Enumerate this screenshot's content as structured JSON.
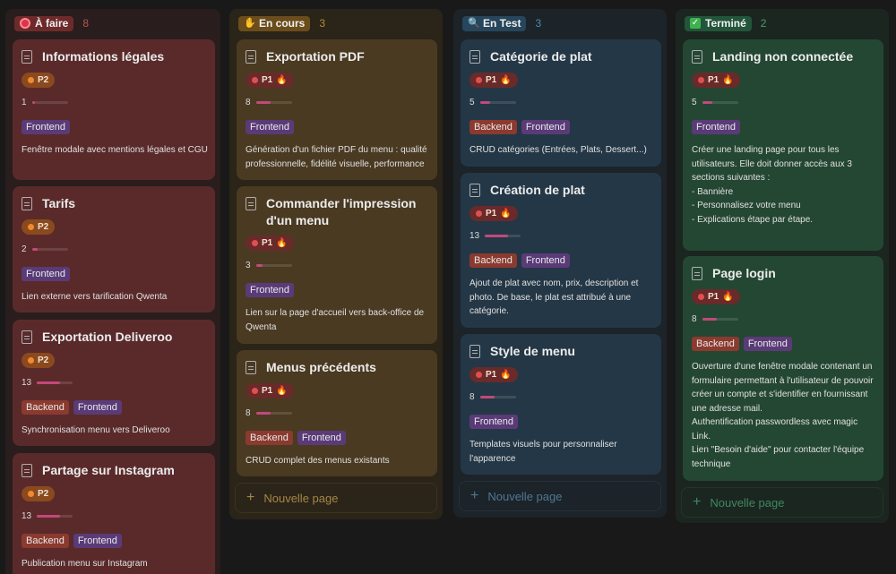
{
  "columns": [
    {
      "status": "À faire",
      "count": "8",
      "icon": "stop-sign-icon",
      "cards": [
        {
          "title": "Informations légales",
          "priority": "P2",
          "points": "1",
          "progress": 0.08,
          "tags": [
            "Frontend"
          ],
          "description": "Fenêtre modale avec mentions légales et CGU"
        },
        {
          "title": "Tarifs",
          "priority": "P2",
          "points": "2",
          "progress": 0.15,
          "tags": [
            "Frontend"
          ],
          "description": "Lien externe vers tarification Qwenta"
        },
        {
          "title": "Exportation Deliveroo",
          "priority": "P2",
          "points": "13",
          "progress": 0.65,
          "tags": [
            "Backend",
            "Frontend"
          ],
          "description": "Synchronisation menu vers Deliveroo"
        },
        {
          "title": "Partage sur Instagram",
          "priority": "P2",
          "points": "13",
          "progress": 0.65,
          "tags": [
            "Backend",
            "Frontend"
          ],
          "description": "Publication menu sur Instagram"
        }
      ]
    },
    {
      "status": "En cours",
      "count": "3",
      "icon": "raised-hands-icon",
      "new_page": "Nouvelle page",
      "cards": [
        {
          "title": "Exportation PDF",
          "priority": "P1",
          "points": "8",
          "progress": 0.4,
          "tags": [
            "Frontend"
          ],
          "description": "Génération d'un fichier PDF du menu : qualité professionnelle, fidélité visuelle, performance"
        },
        {
          "title": "Commander l'impression d'un menu",
          "priority": "P1",
          "points": "3",
          "progress": 0.18,
          "tags": [
            "Frontend"
          ],
          "description": " Lien sur la page d'accueil vers back-office de Qwenta"
        },
        {
          "title": "Menus précédents",
          "priority": "P1",
          "points": "8",
          "progress": 0.4,
          "tags": [
            "Backend",
            "Frontend"
          ],
          "description": "CRUD complet des menus existants"
        }
      ]
    },
    {
      "status": "En Test",
      "count": "3",
      "icon": "magnifier-icon",
      "new_page": "Nouvelle page",
      "cards": [
        {
          "title": "Catégorie de plat",
          "priority": "P1",
          "points": "5",
          "progress": 0.28,
          "tags": [
            "Backend",
            "Frontend"
          ],
          "description": "CRUD catégories (Entrées, Plats, Dessert...)"
        },
        {
          "title": "Création de plat",
          "priority": "P1",
          "points": "13",
          "progress": 0.65,
          "tags": [
            "Backend",
            "Frontend"
          ],
          "description": "Ajout de plat avec nom, prix, description et photo. De base, le plat est attribué à une catégorie."
        },
        {
          "title": "Style de menu",
          "priority": "P1",
          "points": "8",
          "progress": 0.4,
          "tags": [
            "Frontend"
          ],
          "description": "Templates visuels pour personnaliser l'apparence"
        }
      ]
    },
    {
      "status": "Terminé",
      "count": "2",
      "icon": "check-box-icon",
      "new_page": "Nouvelle page",
      "cards": [
        {
          "title": "Landing non connectée",
          "priority": "P1",
          "points": "5",
          "progress": 0.28,
          "tags": [
            "Frontend"
          ],
          "description": "Créer une landing page pour tous les utilisateurs. Elle doit donner accès aux 3 sections suivantes :\n- Bannière\n- Personnalisez votre menu\n- Explications étape par étape."
        },
        {
          "title": "Page login",
          "priority": "P1",
          "points": "8",
          "progress": 0.4,
          "tags": [
            "Backend",
            "Frontend"
          ],
          "description": "Ouverture d'une fenêtre modale contenant un formulaire permettant à l'utilisateur de pouvoir créer un compte et s'identifier en fournissant une adresse mail.\nAuthentification passwordless avec magic Link.\nLien \"Besoin d'aide\" pour contacter l'équipe technique"
        }
      ]
    }
  ]
}
